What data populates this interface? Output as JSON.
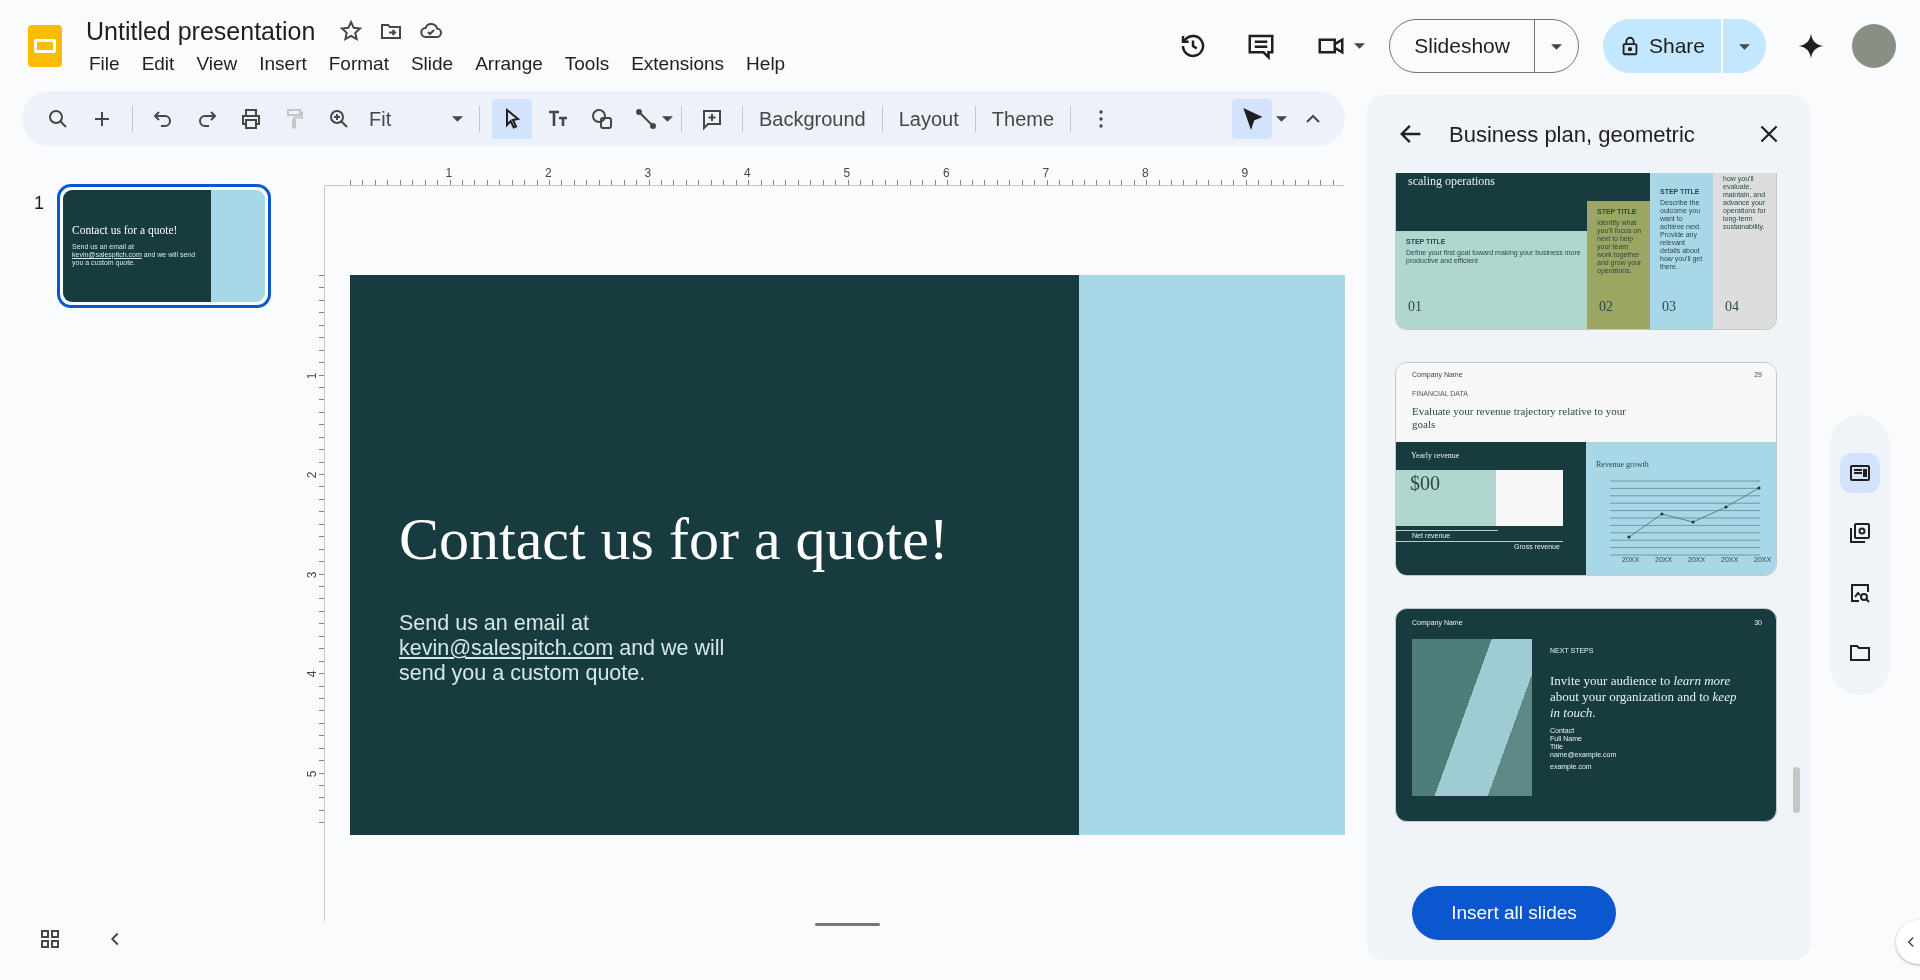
{
  "app": {
    "title": "Untitled presentation",
    "menu": [
      "File",
      "Edit",
      "View",
      "Insert",
      "Format",
      "Slide",
      "Arrange",
      "Tools",
      "Extensions",
      "Help"
    ]
  },
  "header": {
    "slideshow": "Slideshow",
    "share": "Share"
  },
  "toolbar": {
    "paint_format": {
      "disabled": true
    },
    "zoom": "Fit",
    "select_tool": {
      "selected": true
    },
    "actions": [
      "Background",
      "Layout",
      "Theme"
    ],
    "pointer_tool": {
      "selected": true
    }
  },
  "filmstrip": {
    "slides": [
      {
        "number": "1",
        "selected": true,
        "title": "Contact us for a quote!",
        "text_before": "Send us an email at",
        "link": "kevin@salespitch.com",
        "text_after": "and we will send you a custom quote."
      }
    ]
  },
  "rulers": {
    "horizontal": [
      "1",
      "2",
      "3",
      "4",
      "5",
      "6",
      "7",
      "8",
      "9"
    ],
    "vertical": [
      "1",
      "2",
      "3",
      "4",
      "5"
    ]
  },
  "slide": {
    "title": "Contact us for a quote!",
    "text_before": "Send us an email at",
    "link": "kevin@salespitch.com",
    "text_after": "and we will send you a custom quote."
  },
  "panel": {
    "title": "Business plan, geometric",
    "button": "Insert all slides",
    "templates": [
      {
        "kind": "steps",
        "heading": "scaling operations",
        "steps": [
          {
            "label": "STEP TITLE",
            "text": "Define your first goal toward making your business more productive and efficient",
            "number": "01"
          },
          {
            "label": "STEP TITLE",
            "text": "Identify what you'll focus on next to help your team work together and grow your operations.",
            "number": "02"
          },
          {
            "label": "STEP TITLE",
            "text": "Describe the outcome you want to achieve next. Provide any relevant details about how you'll get there.",
            "number": "03"
          },
          {
            "text": "how you'll evaluate, maintain, and advance your operations for long-term sustainability.",
            "number": "04"
          }
        ]
      },
      {
        "kind": "financial",
        "company": "Company Name",
        "page": "29",
        "eyebrow": "FINANCIAL DATA",
        "heading": "Evaluate your revenue trajectory relative to your goals",
        "left_title": "Yearly revenue",
        "amount": "$00",
        "net_label": "Net revenue",
        "gross_label": "Gross revenue",
        "chart_title": "Revenue growth",
        "x_labels": [
          "20XX",
          "20XX",
          "20XX",
          "20XX",
          "20XX"
        ]
      },
      {
        "kind": "next_steps",
        "company": "Company Name",
        "page": "30",
        "eyebrow": "NEXT STEPS",
        "heading": "Invite your audience to *learn more* about your organization and to *keep in touch*.",
        "contact": [
          "Contact",
          "Full Name",
          "Title",
          "name@example.com"
        ],
        "website": "example.com"
      }
    ]
  },
  "side_rail": [
    {
      "selected": true
    },
    {
      "selected": false
    },
    {
      "selected": false
    },
    {
      "selected": false
    }
  ]
}
